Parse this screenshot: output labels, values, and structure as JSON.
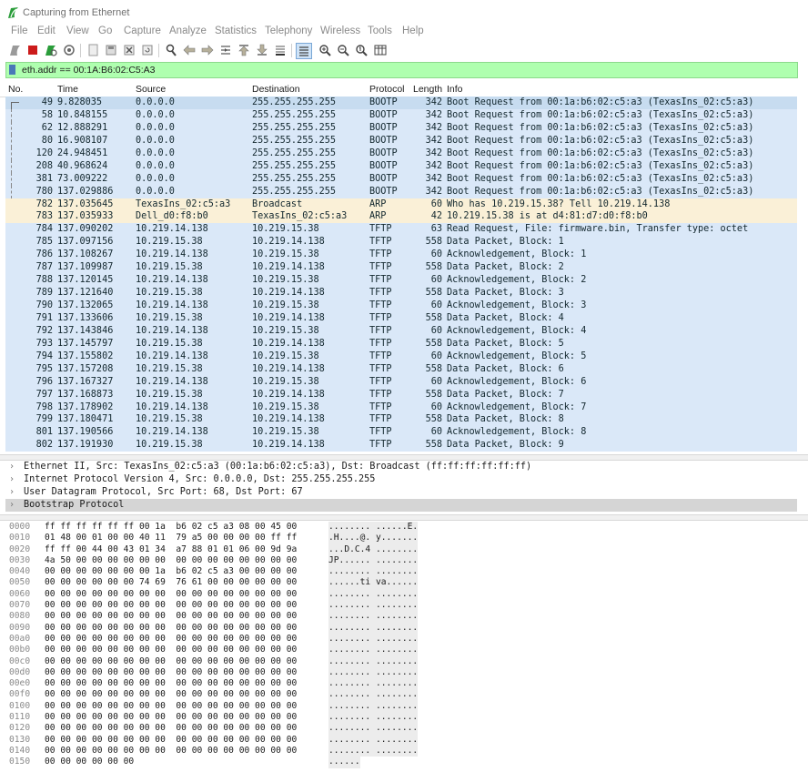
{
  "window": {
    "title": "Capturing from Ethernet"
  },
  "menu": [
    "File",
    "Edit",
    "View",
    "Go",
    "Capture",
    "Analyze",
    "Statistics",
    "Telephony",
    "Wireless",
    "Tools",
    "Help"
  ],
  "toolbar_icons": [
    "shark-fin-start-icon",
    "stop-icon",
    "restart-icon",
    "options-icon",
    "open-file-icon",
    "save-icon",
    "close-file-icon",
    "reload-icon",
    "find-icon",
    "go-back-icon",
    "go-forward-icon",
    "go-to-packet-icon",
    "first-packet-icon",
    "last-packet-icon",
    "autoscroll-icon",
    "colorize-icon",
    "zoom-in-icon",
    "zoom-out-icon",
    "normal-size-icon",
    "resize-columns-icon"
  ],
  "filter": {
    "value": "eth.addr == 00:1A:B6:02:C5:A3"
  },
  "columns": {
    "no": "No.",
    "time": "Time",
    "source": "Source",
    "destination": "Destination",
    "protocol": "Protocol",
    "length": "Length",
    "info": "Info"
  },
  "packets": [
    {
      "no": "49",
      "time": "9.828035",
      "src": "0.0.0.0",
      "dst": "255.255.255.255",
      "proto": "BOOTP",
      "len": "342",
      "info": "Boot Request from 00:1a:b6:02:c5:a3 (TexasIns_02:c5:a3)",
      "cls": "sel"
    },
    {
      "no": "58",
      "time": "10.848155",
      "src": "0.0.0.0",
      "dst": "255.255.255.255",
      "proto": "BOOTP",
      "len": "342",
      "info": "Boot Request from 00:1a:b6:02:c5:a3 (TexasIns_02:c5:a3)",
      "cls": "bootp"
    },
    {
      "no": "62",
      "time": "12.888291",
      "src": "0.0.0.0",
      "dst": "255.255.255.255",
      "proto": "BOOTP",
      "len": "342",
      "info": "Boot Request from 00:1a:b6:02:c5:a3 (TexasIns_02:c5:a3)",
      "cls": "bootp"
    },
    {
      "no": "80",
      "time": "16.908107",
      "src": "0.0.0.0",
      "dst": "255.255.255.255",
      "proto": "BOOTP",
      "len": "342",
      "info": "Boot Request from 00:1a:b6:02:c5:a3 (TexasIns_02:c5:a3)",
      "cls": "bootp"
    },
    {
      "no": "120",
      "time": "24.948451",
      "src": "0.0.0.0",
      "dst": "255.255.255.255",
      "proto": "BOOTP",
      "len": "342",
      "info": "Boot Request from 00:1a:b6:02:c5:a3 (TexasIns_02:c5:a3)",
      "cls": "bootp"
    },
    {
      "no": "208",
      "time": "40.968624",
      "src": "0.0.0.0",
      "dst": "255.255.255.255",
      "proto": "BOOTP",
      "len": "342",
      "info": "Boot Request from 00:1a:b6:02:c5:a3 (TexasIns_02:c5:a3)",
      "cls": "bootp"
    },
    {
      "no": "381",
      "time": "73.009222",
      "src": "0.0.0.0",
      "dst": "255.255.255.255",
      "proto": "BOOTP",
      "len": "342",
      "info": "Boot Request from 00:1a:b6:02:c5:a3 (TexasIns_02:c5:a3)",
      "cls": "bootp"
    },
    {
      "no": "780",
      "time": "137.029886",
      "src": "0.0.0.0",
      "dst": "255.255.255.255",
      "proto": "BOOTP",
      "len": "342",
      "info": "Boot Request from 00:1a:b6:02:c5:a3 (TexasIns_02:c5:a3)",
      "cls": "bootp"
    },
    {
      "no": "782",
      "time": "137.035645",
      "src": "TexasIns_02:c5:a3",
      "dst": "Broadcast",
      "proto": "ARP",
      "len": "60",
      "info": "Who has 10.219.15.38? Tell 10.219.14.138",
      "cls": "arp"
    },
    {
      "no": "783",
      "time": "137.035933",
      "src": "Dell_d0:f8:b0",
      "dst": "TexasIns_02:c5:a3",
      "proto": "ARP",
      "len": "42",
      "info": "10.219.15.38 is at d4:81:d7:d0:f8:b0",
      "cls": "arp"
    },
    {
      "no": "784",
      "time": "137.090202",
      "src": "10.219.14.138",
      "dst": "10.219.15.38",
      "proto": "TFTP",
      "len": "63",
      "info": "Read Request, File: firmware.bin, Transfer type: octet",
      "cls": "tftp"
    },
    {
      "no": "785",
      "time": "137.097156",
      "src": "10.219.15.38",
      "dst": "10.219.14.138",
      "proto": "TFTP",
      "len": "558",
      "info": "Data Packet, Block: 1",
      "cls": "tftp"
    },
    {
      "no": "786",
      "time": "137.108267",
      "src": "10.219.14.138",
      "dst": "10.219.15.38",
      "proto": "TFTP",
      "len": "60",
      "info": "Acknowledgement, Block: 1",
      "cls": "tftp"
    },
    {
      "no": "787",
      "time": "137.109987",
      "src": "10.219.15.38",
      "dst": "10.219.14.138",
      "proto": "TFTP",
      "len": "558",
      "info": "Data Packet, Block: 2",
      "cls": "tftp"
    },
    {
      "no": "788",
      "time": "137.120145",
      "src": "10.219.14.138",
      "dst": "10.219.15.38",
      "proto": "TFTP",
      "len": "60",
      "info": "Acknowledgement, Block: 2",
      "cls": "tftp"
    },
    {
      "no": "789",
      "time": "137.121640",
      "src": "10.219.15.38",
      "dst": "10.219.14.138",
      "proto": "TFTP",
      "len": "558",
      "info": "Data Packet, Block: 3",
      "cls": "tftp"
    },
    {
      "no": "790",
      "time": "137.132065",
      "src": "10.219.14.138",
      "dst": "10.219.15.38",
      "proto": "TFTP",
      "len": "60",
      "info": "Acknowledgement, Block: 3",
      "cls": "tftp"
    },
    {
      "no": "791",
      "time": "137.133606",
      "src": "10.219.15.38",
      "dst": "10.219.14.138",
      "proto": "TFTP",
      "len": "558",
      "info": "Data Packet, Block: 4",
      "cls": "tftp"
    },
    {
      "no": "792",
      "time": "137.143846",
      "src": "10.219.14.138",
      "dst": "10.219.15.38",
      "proto": "TFTP",
      "len": "60",
      "info": "Acknowledgement, Block: 4",
      "cls": "tftp"
    },
    {
      "no": "793",
      "time": "137.145797",
      "src": "10.219.15.38",
      "dst": "10.219.14.138",
      "proto": "TFTP",
      "len": "558",
      "info": "Data Packet, Block: 5",
      "cls": "tftp"
    },
    {
      "no": "794",
      "time": "137.155802",
      "src": "10.219.14.138",
      "dst": "10.219.15.38",
      "proto": "TFTP",
      "len": "60",
      "info": "Acknowledgement, Block: 5",
      "cls": "tftp"
    },
    {
      "no": "795",
      "time": "137.157208",
      "src": "10.219.15.38",
      "dst": "10.219.14.138",
      "proto": "TFTP",
      "len": "558",
      "info": "Data Packet, Block: 6",
      "cls": "tftp"
    },
    {
      "no": "796",
      "time": "137.167327",
      "src": "10.219.14.138",
      "dst": "10.219.15.38",
      "proto": "TFTP",
      "len": "60",
      "info": "Acknowledgement, Block: 6",
      "cls": "tftp"
    },
    {
      "no": "797",
      "time": "137.168873",
      "src": "10.219.15.38",
      "dst": "10.219.14.138",
      "proto": "TFTP",
      "len": "558",
      "info": "Data Packet, Block: 7",
      "cls": "tftp"
    },
    {
      "no": "798",
      "time": "137.178902",
      "src": "10.219.14.138",
      "dst": "10.219.15.38",
      "proto": "TFTP",
      "len": "60",
      "info": "Acknowledgement, Block: 7",
      "cls": "tftp"
    },
    {
      "no": "799",
      "time": "137.180471",
      "src": "10.219.15.38",
      "dst": "10.219.14.138",
      "proto": "TFTP",
      "len": "558",
      "info": "Data Packet, Block: 8",
      "cls": "tftp"
    },
    {
      "no": "801",
      "time": "137.190566",
      "src": "10.219.14.138",
      "dst": "10.219.15.38",
      "proto": "TFTP",
      "len": "60",
      "info": "Acknowledgement, Block: 8",
      "cls": "tftp"
    },
    {
      "no": "802",
      "time": "137.191930",
      "src": "10.219.15.38",
      "dst": "10.219.14.138",
      "proto": "TFTP",
      "len": "558",
      "info": "Data Packet, Block: 9",
      "cls": "tftp"
    }
  ],
  "details": [
    {
      "text": "Ethernet II, Src: TexasIns_02:c5:a3 (00:1a:b6:02:c5:a3), Dst: Broadcast (ff:ff:ff:ff:ff:ff)",
      "hl": false
    },
    {
      "text": "Internet Protocol Version 4, Src: 0.0.0.0, Dst: 255.255.255.255",
      "hl": false
    },
    {
      "text": "User Datagram Protocol, Src Port: 68, Dst Port: 67",
      "hl": false
    },
    {
      "text": "Bootstrap Protocol",
      "hl": true
    }
  ],
  "bytes": [
    {
      "off": "0000",
      "hex": "ff ff ff ff ff ff 00 1a  b6 02 c5 a3 08 00 45 00",
      "ascii": "........ ......E."
    },
    {
      "off": "0010",
      "hex": "01 48 00 01 00 00 40 11  79 a5 00 00 00 00 ff ff",
      "ascii": ".H....@. y......."
    },
    {
      "off": "0020",
      "hex": "ff ff 00 44 00 43 01 34  a7 88 01 01 06 00 9d 9a",
      "ascii": "...D.C.4 ........"
    },
    {
      "off": "0030",
      "hex": "4a 50 00 00 00 00 00 00  00 00 00 00 00 00 00 00",
      "ascii": "JP...... ........"
    },
    {
      "off": "0040",
      "hex": "00 00 00 00 00 00 00 1a  b6 02 c5 a3 00 00 00 00",
      "ascii": "........ ........"
    },
    {
      "off": "0050",
      "hex": "00 00 00 00 00 00 74 69  76 61 00 00 00 00 00 00",
      "ascii": "......ti va......"
    },
    {
      "off": "0060",
      "hex": "00 00 00 00 00 00 00 00  00 00 00 00 00 00 00 00",
      "ascii": "........ ........"
    },
    {
      "off": "0070",
      "hex": "00 00 00 00 00 00 00 00  00 00 00 00 00 00 00 00",
      "ascii": "........ ........"
    },
    {
      "off": "0080",
      "hex": "00 00 00 00 00 00 00 00  00 00 00 00 00 00 00 00",
      "ascii": "........ ........"
    },
    {
      "off": "0090",
      "hex": "00 00 00 00 00 00 00 00  00 00 00 00 00 00 00 00",
      "ascii": "........ ........"
    },
    {
      "off": "00a0",
      "hex": "00 00 00 00 00 00 00 00  00 00 00 00 00 00 00 00",
      "ascii": "........ ........"
    },
    {
      "off": "00b0",
      "hex": "00 00 00 00 00 00 00 00  00 00 00 00 00 00 00 00",
      "ascii": "........ ........"
    },
    {
      "off": "00c0",
      "hex": "00 00 00 00 00 00 00 00  00 00 00 00 00 00 00 00",
      "ascii": "........ ........"
    },
    {
      "off": "00d0",
      "hex": "00 00 00 00 00 00 00 00  00 00 00 00 00 00 00 00",
      "ascii": "........ ........"
    },
    {
      "off": "00e0",
      "hex": "00 00 00 00 00 00 00 00  00 00 00 00 00 00 00 00",
      "ascii": "........ ........"
    },
    {
      "off": "00f0",
      "hex": "00 00 00 00 00 00 00 00  00 00 00 00 00 00 00 00",
      "ascii": "........ ........"
    },
    {
      "off": "0100",
      "hex": "00 00 00 00 00 00 00 00  00 00 00 00 00 00 00 00",
      "ascii": "........ ........"
    },
    {
      "off": "0110",
      "hex": "00 00 00 00 00 00 00 00  00 00 00 00 00 00 00 00",
      "ascii": "........ ........"
    },
    {
      "off": "0120",
      "hex": "00 00 00 00 00 00 00 00  00 00 00 00 00 00 00 00",
      "ascii": "........ ........"
    },
    {
      "off": "0130",
      "hex": "00 00 00 00 00 00 00 00  00 00 00 00 00 00 00 00",
      "ascii": "........ ........"
    },
    {
      "off": "0140",
      "hex": "00 00 00 00 00 00 00 00  00 00 00 00 00 00 00 00",
      "ascii": "........ ........"
    },
    {
      "off": "0150",
      "hex": "00 00 00 00 00 00",
      "ascii": "......"
    }
  ]
}
